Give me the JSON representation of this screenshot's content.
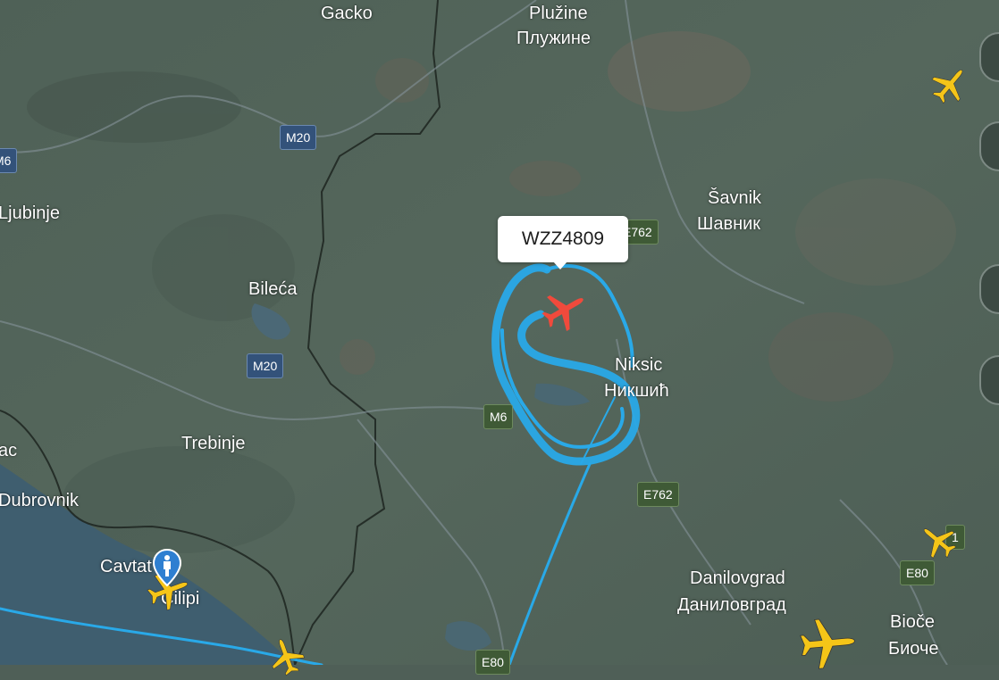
{
  "flight_label": "WZZ4809",
  "places": {
    "gacko": "Gacko",
    "pluzine": "Plužine",
    "pluzine_cyr": "Плужине",
    "savnik": "Šavnik",
    "savnik_cyr": "Шавник",
    "ljubinje": "Ljubinje",
    "bileca": "Bileća",
    "niksic": "Niksic",
    "niksic_cyr": "Никшић",
    "trebinje": "Trebinje",
    "dubrovnik": "Dubrovnik",
    "cavtat": "Cavtat",
    "cilipi": "Čilipi",
    "danilovgrad": "Danilovgrad",
    "danilovgrad_cyr": "Даниловград",
    "bioce": "Bioče",
    "bioce_cyr": "Биоче",
    "ac_partial": "ac"
  },
  "roads": {
    "m20_top": "M20",
    "m20_mid": "M20",
    "m6_left": "M6",
    "m6_mid": "M6",
    "e762_top": "E762",
    "e762_mid": "E762",
    "e80_right": "E80",
    "e80_bottom": "E80",
    "e80_badge_partial": "1"
  },
  "colors": {
    "terrain": "#55665c",
    "water": "#3f5e6f",
    "track": "#29a9e8",
    "selected_plane": "#f04a3c",
    "other_planes": "#f5c518",
    "poi_marker": "#2e7fd1"
  },
  "icons": {
    "selected_aircraft": "airplane-icon",
    "other_aircraft": "airplane-icon",
    "poi": "airport-pin-icon"
  }
}
